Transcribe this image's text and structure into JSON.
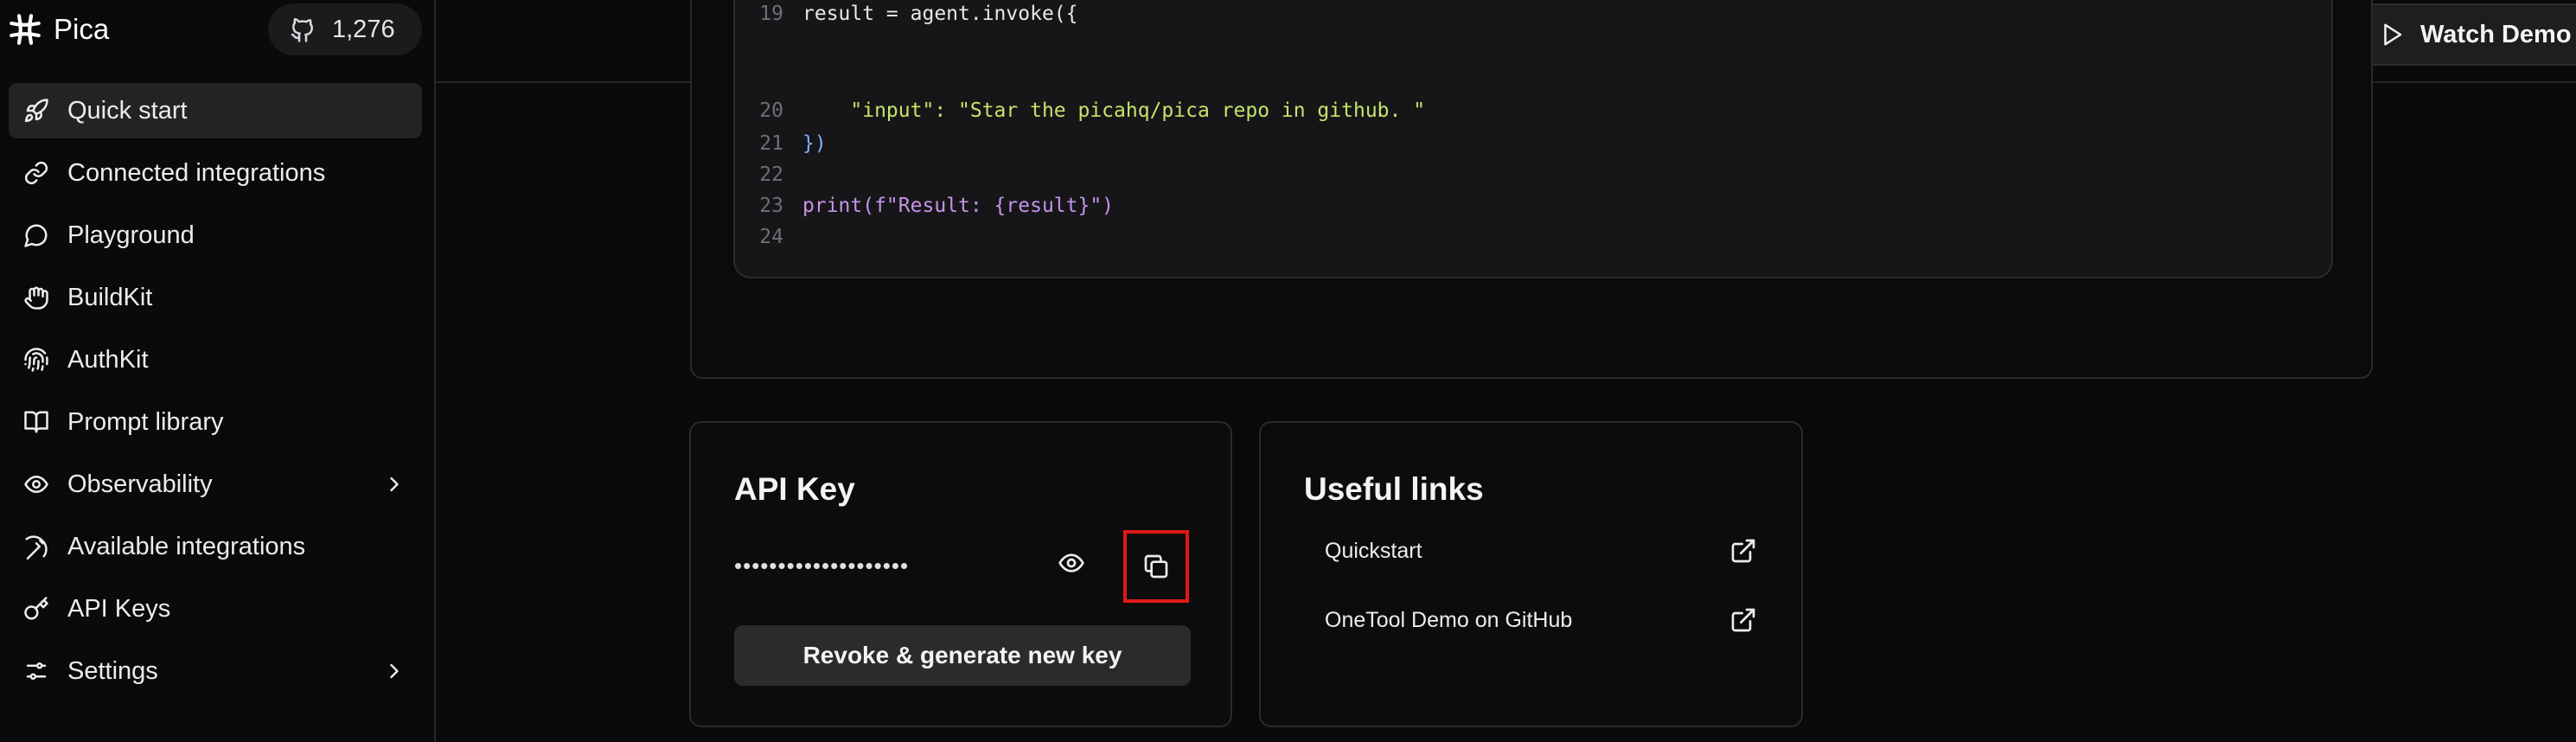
{
  "app": {
    "name": "Pica",
    "github_stars": "1,276"
  },
  "sidebar": {
    "items": [
      {
        "label": "Quick start",
        "icon": "rocket-icon",
        "active": true
      },
      {
        "label": "Connected integrations",
        "icon": "link-icon"
      },
      {
        "label": "Playground",
        "icon": "chat-bubble-icon"
      },
      {
        "label": "BuildKit",
        "icon": "hand-icon"
      },
      {
        "label": "AuthKit",
        "icon": "fingerprint-icon"
      },
      {
        "label": "Prompt library",
        "icon": "book-open-icon"
      },
      {
        "label": "Observability",
        "icon": "eye-icon",
        "expandable": true
      },
      {
        "label": "Available integrations",
        "icon": "pickaxe-icon"
      },
      {
        "label": "API Keys",
        "icon": "key-icon"
      },
      {
        "label": "Settings",
        "icon": "sliders-icon",
        "expandable": true
      }
    ]
  },
  "topbar": {
    "watch_demo_label": "Watch Demo"
  },
  "code": {
    "lines": [
      {
        "n": "19",
        "text": "result = agent.invoke({"
      },
      {
        "n": "20",
        "text": "    \"input\": \"Star the picahq/pica repo in github. \""
      },
      {
        "n": "21",
        "text": "})"
      },
      {
        "n": "22",
        "text": ""
      },
      {
        "n": "23",
        "text": "print(f\"Result: {result}\")"
      },
      {
        "n": "24",
        "text": ""
      }
    ]
  },
  "api_key": {
    "title": "API Key",
    "masked_value": "••••••••••••••••••••",
    "revoke_label": "Revoke & generate new key"
  },
  "useful_links": {
    "title": "Useful links",
    "items": [
      {
        "label": "Quickstart"
      },
      {
        "label": "OneTool Demo on GitHub"
      }
    ]
  },
  "colors": {
    "background": "#0a0a0b",
    "highlight_box": "#e01818",
    "string": "#c6e36a",
    "keyword_fn": "#c792ea"
  }
}
